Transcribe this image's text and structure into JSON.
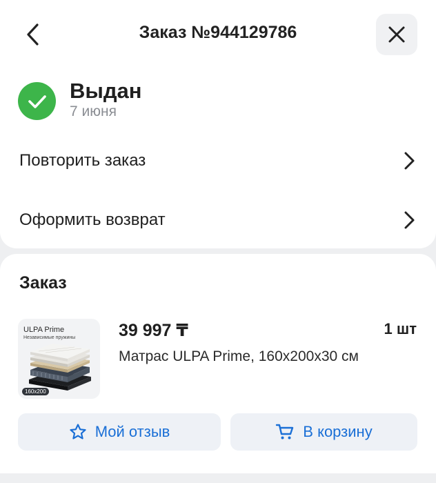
{
  "header": {
    "title": "Заказ №944129786"
  },
  "status": {
    "title": "Выдан",
    "date": "7 июня"
  },
  "actions": [
    {
      "label": "Повторить заказ"
    },
    {
      "label": "Оформить возврат"
    }
  ],
  "order": {
    "heading": "Заказ",
    "item": {
      "image_brand": "ULPA Prime",
      "image_subtitle": "Независимые пружины",
      "image_size_badge": "160x200",
      "price": "39 997 ₸",
      "quantity": "1 шт",
      "name": "Матрас ULPA Prime, 160x200x30 см"
    },
    "buttons": {
      "review": "Мой отзыв",
      "cart": "В корзину"
    }
  },
  "colors": {
    "accent": "#1a6fd6",
    "success": "#3db54a",
    "background": "#eeeff1"
  },
  "icons": [
    "back-icon",
    "close-icon",
    "check-icon",
    "chevron-right-icon",
    "star-icon",
    "cart-icon"
  ]
}
